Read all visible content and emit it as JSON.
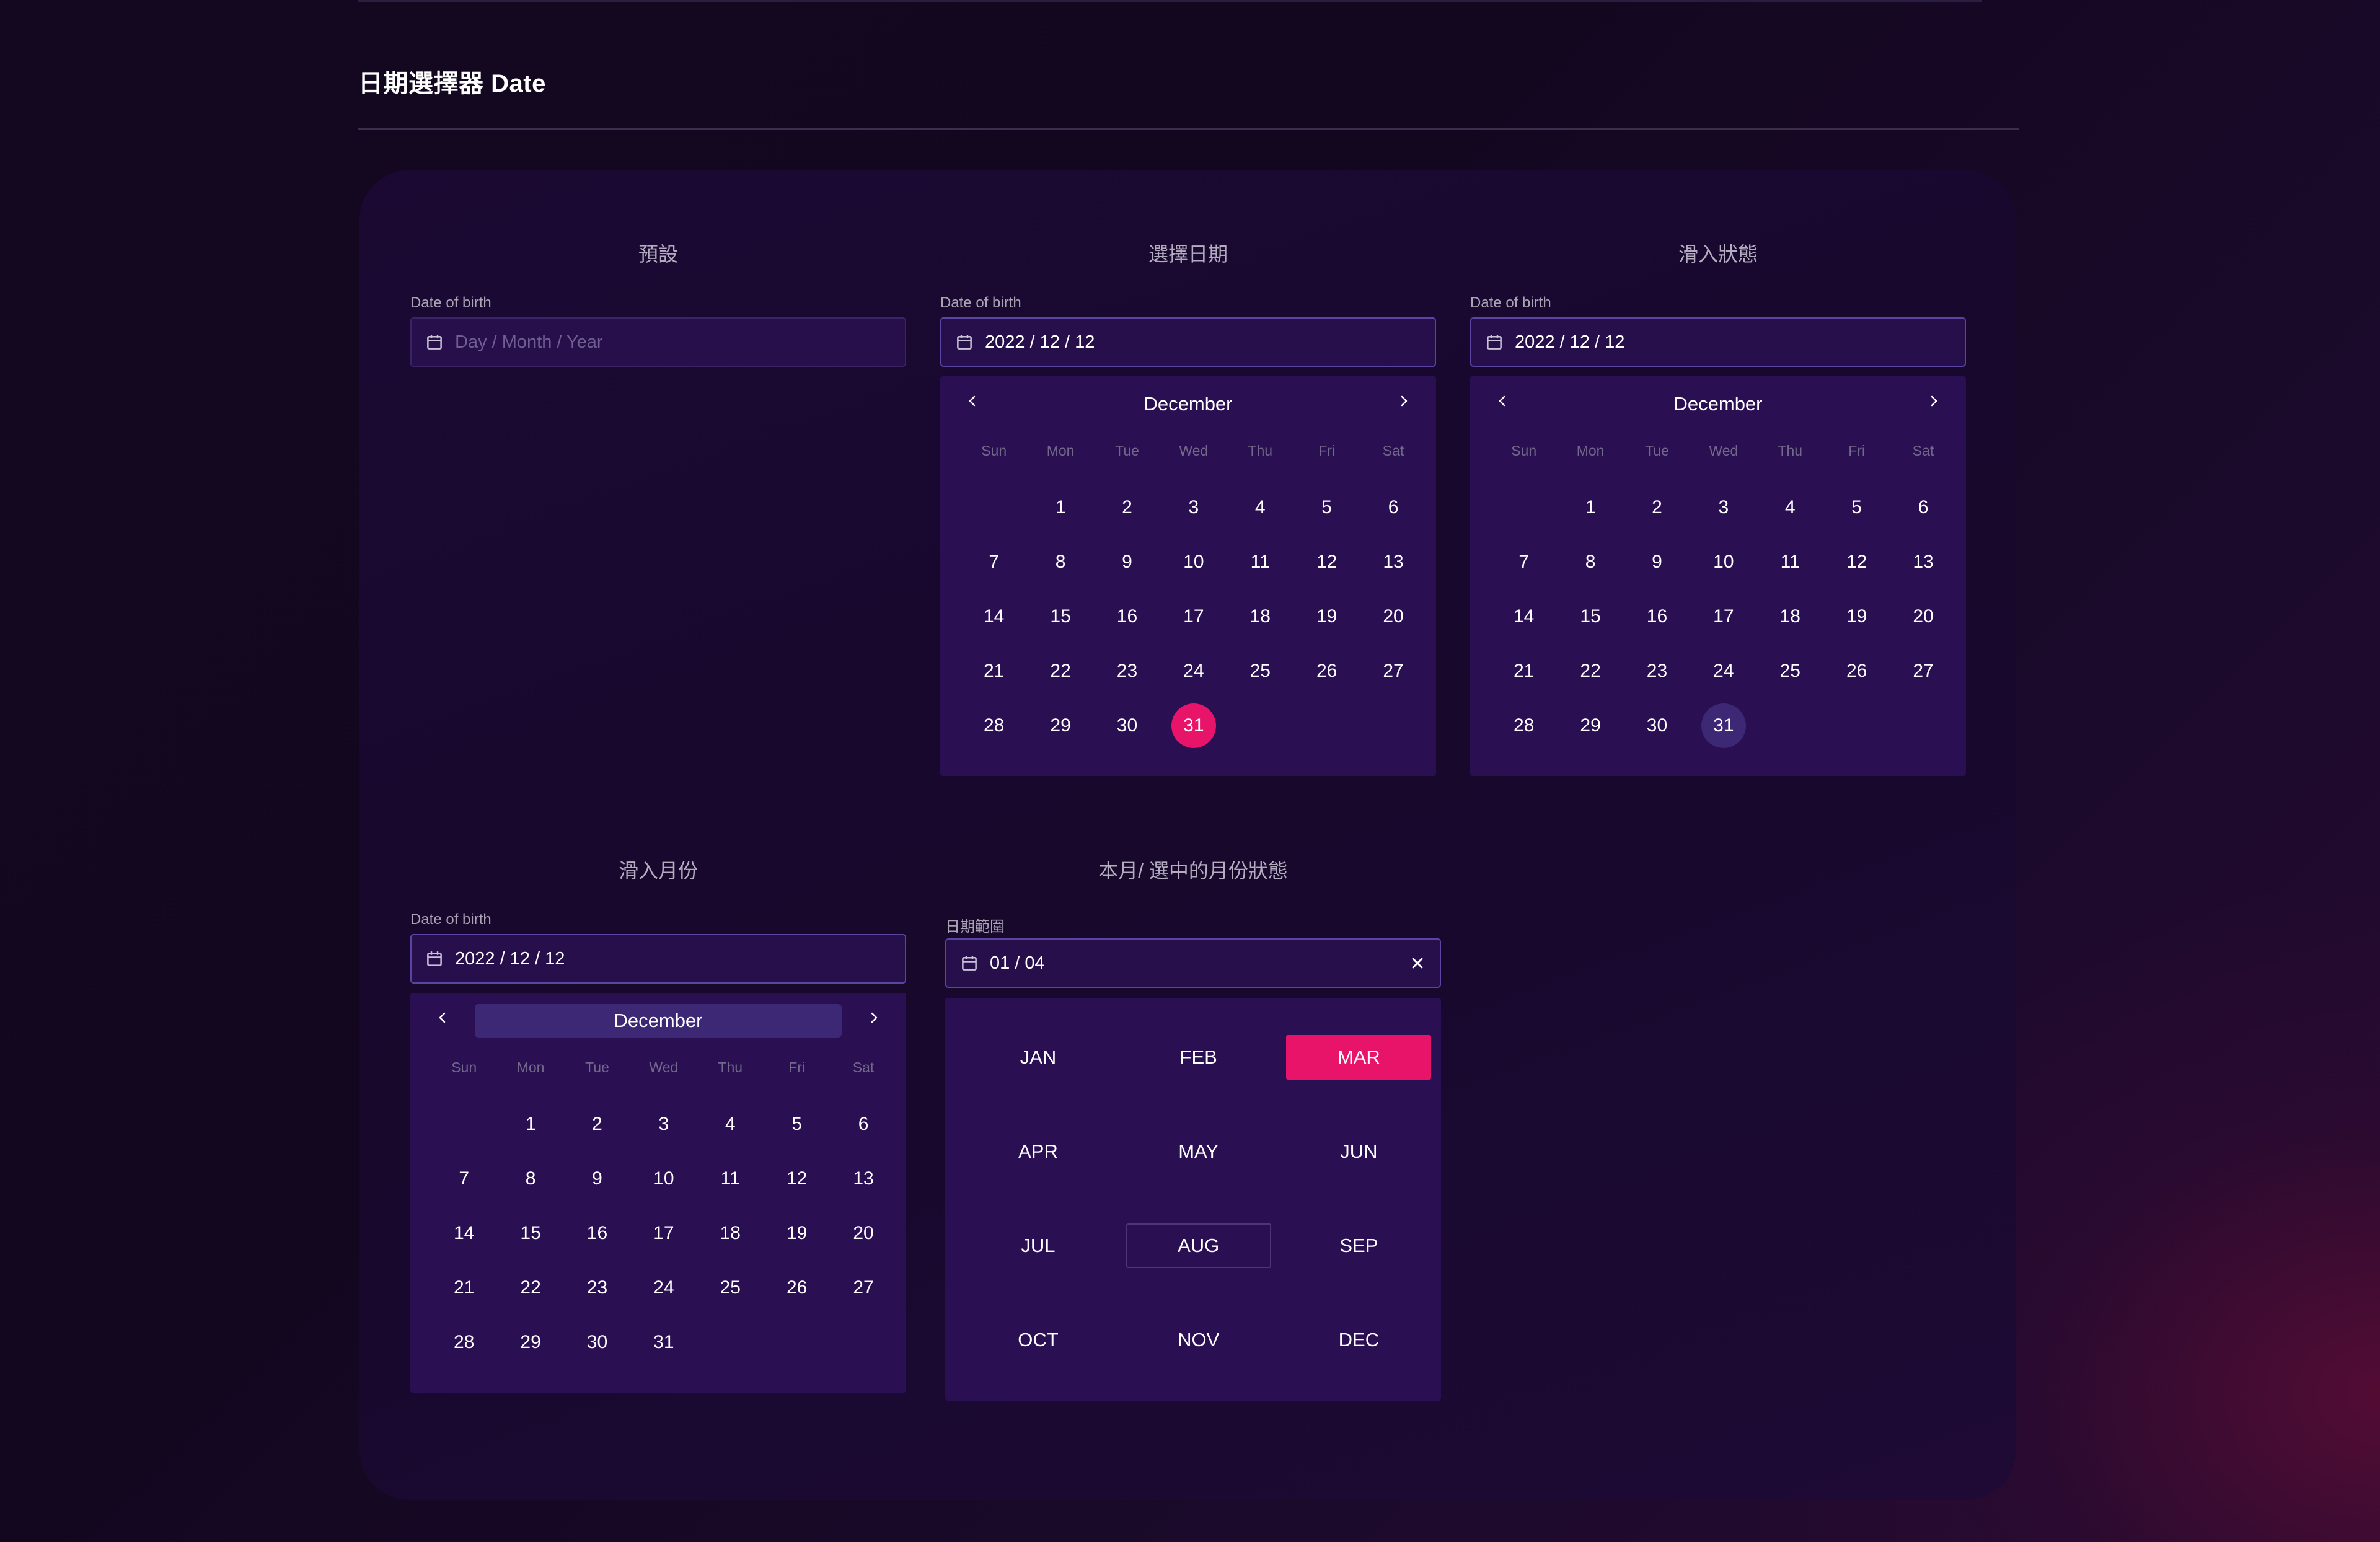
{
  "page": {
    "title": "日期選擇器 Date"
  },
  "weekdays": [
    "Sun",
    "Mon",
    "Tue",
    "Wed",
    "Thu",
    "Fri",
    "Sat"
  ],
  "colors": {
    "accent": "#e8146a",
    "panel": "#2a0f53",
    "hover": "#3d2875"
  },
  "sections": {
    "default": {
      "title": "預設",
      "label": "Date of birth",
      "placeholder": "Day / Month / Year"
    },
    "selected": {
      "title": "選擇日期",
      "label": "Date of birth",
      "value": "2022 / 12 / 12",
      "month": "December",
      "selected_day": "31"
    },
    "hover_state": {
      "title": "滑入狀態",
      "label": "Date of birth",
      "value": "2022 / 12 / 12",
      "month": "December",
      "hovered_day": "31"
    },
    "hover_month": {
      "title": "滑入月份",
      "label": "Date of birth",
      "value": "2022 / 12 / 12",
      "month": "December"
    },
    "month_state": {
      "title": "本月/ 選中的月份狀態",
      "label": "日期範圍",
      "value": "01 / 04",
      "months": [
        "JAN",
        "FEB",
        "MAR",
        "APR",
        "MAY",
        "JUN",
        "JUL",
        "AUG",
        "SEP",
        "OCT",
        "NOV",
        "DEC"
      ],
      "selected_month": "MAR",
      "current_month": "AUG"
    }
  },
  "calendar": {
    "leading_blanks": 1,
    "days": [
      "1",
      "2",
      "3",
      "4",
      "5",
      "6",
      "7",
      "8",
      "9",
      "10",
      "11",
      "12",
      "13",
      "14",
      "15",
      "16",
      "17",
      "18",
      "19",
      "20",
      "21",
      "22",
      "23",
      "24",
      "25",
      "26",
      "27",
      "28",
      "29",
      "30",
      "31"
    ]
  }
}
